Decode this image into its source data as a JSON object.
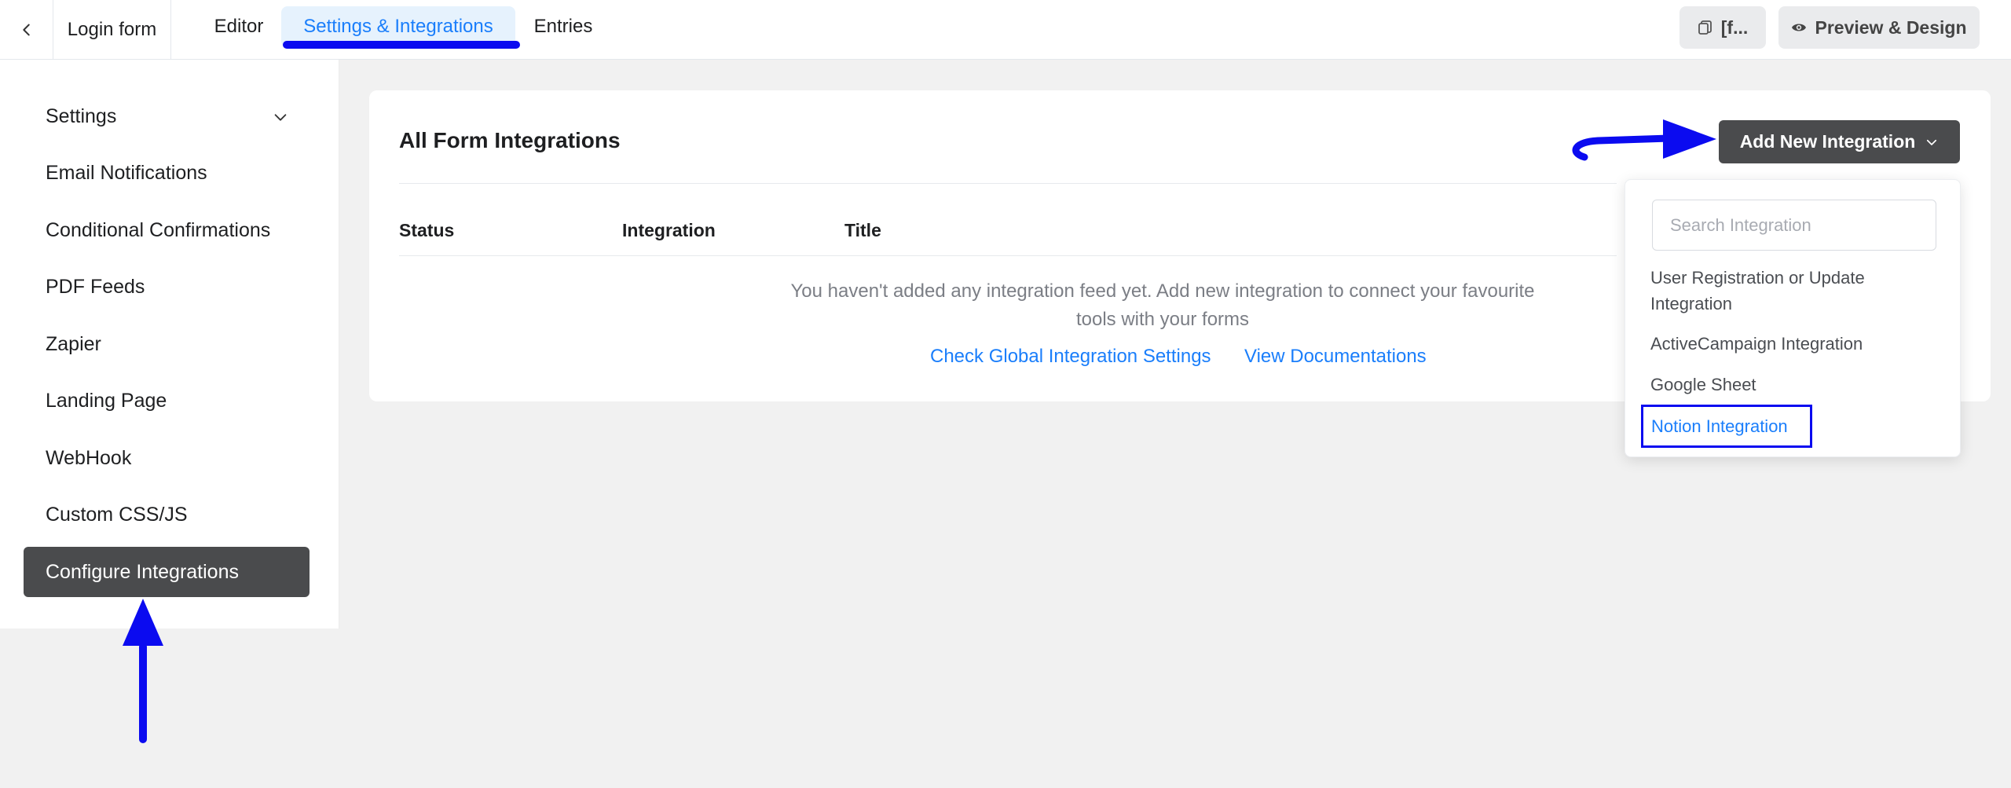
{
  "topbar": {
    "back_icon": "chevron-left-icon",
    "form_name": "Login form",
    "tabs": [
      {
        "label": "Editor"
      },
      {
        "label": "Settings & Integrations",
        "active": true
      },
      {
        "label": "Entries"
      }
    ],
    "shortcode_button": "[f...",
    "preview_button": "Preview & Design"
  },
  "sidebar": {
    "items": [
      {
        "label": "Settings"
      },
      {
        "label": "Email Notifications"
      },
      {
        "label": "Conditional Confirmations"
      },
      {
        "label": "PDF Feeds"
      },
      {
        "label": "Zapier"
      },
      {
        "label": "Landing Page"
      },
      {
        "label": "WebHook"
      },
      {
        "label": "Custom CSS/JS"
      },
      {
        "label": "Configure Integrations",
        "active": true
      }
    ]
  },
  "main": {
    "title": "All Form Integrations",
    "add_button": "Add New Integration",
    "columns": [
      "Status",
      "Integration",
      "Title"
    ],
    "empty_message": "You haven't added any integration feed yet. Add new integration to connect your favourite tools with your forms",
    "links": {
      "global_settings": "Check Global Integration Settings",
      "documentation": "View Documentations"
    }
  },
  "dropdown": {
    "search_placeholder": "Search Integration",
    "items": [
      {
        "label": "User Registration or Update Integration"
      },
      {
        "label": "ActiveCampaign Integration"
      },
      {
        "label": "Google Sheet"
      },
      {
        "label": "Notion Integration",
        "highlighted": true
      }
    ]
  },
  "colors": {
    "accent": "#1a7efb",
    "annotation": "#0b0bf0",
    "dark_button": "#4a4b4d"
  }
}
